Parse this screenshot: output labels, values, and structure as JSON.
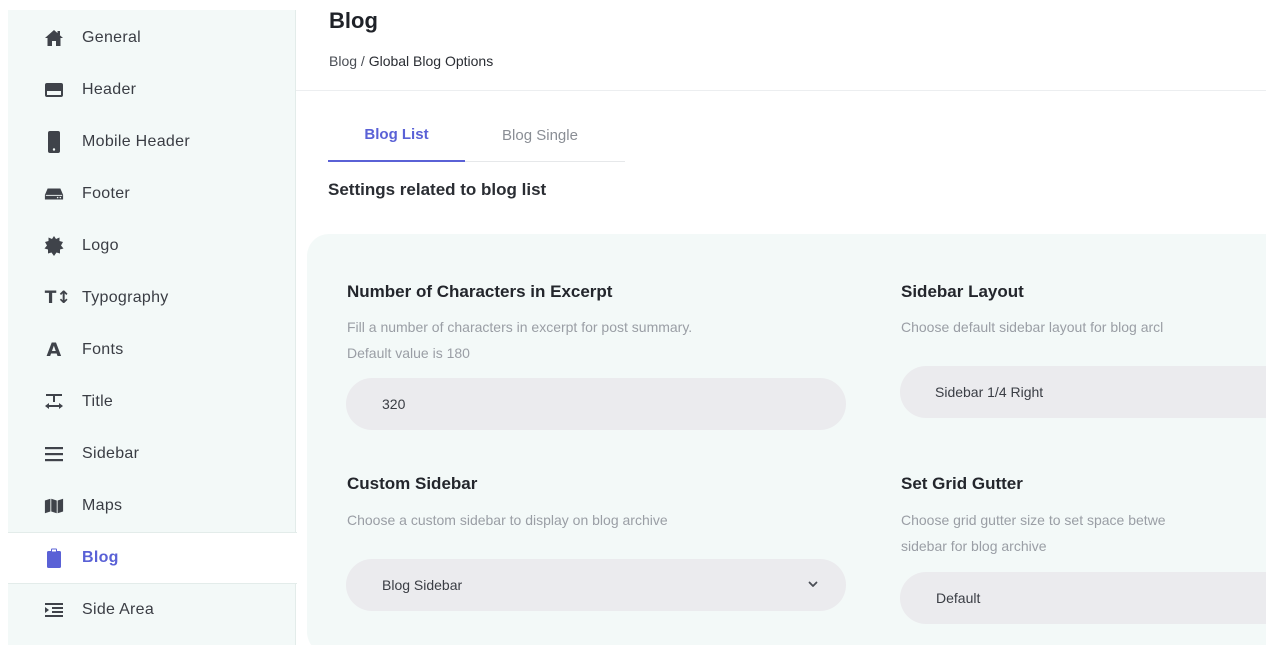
{
  "sidebar": {
    "items": [
      {
        "label": "General",
        "icon": "home-icon"
      },
      {
        "label": "Header",
        "icon": "header-icon"
      },
      {
        "label": "Mobile Header",
        "icon": "mobile-icon"
      },
      {
        "label": "Footer",
        "icon": "footer-icon"
      },
      {
        "label": "Logo",
        "icon": "logo-icon"
      },
      {
        "label": "Typography",
        "icon": "typography-icon"
      },
      {
        "label": "Fonts",
        "icon": "fonts-icon"
      },
      {
        "label": "Title",
        "icon": "title-icon"
      },
      {
        "label": "Sidebar",
        "icon": "sidebar-icon"
      },
      {
        "label": "Maps",
        "icon": "map-icon"
      },
      {
        "label": "Blog",
        "icon": "clipboard-icon",
        "active": true
      },
      {
        "label": "Side Area",
        "icon": "indent-icon"
      }
    ]
  },
  "header": {
    "title": "Blog",
    "breadcrumb_root": "Blog",
    "breadcrumb_sep": " / ",
    "breadcrumb_current": "Global Blog Options"
  },
  "tabs": [
    {
      "label": "Blog List",
      "active": true
    },
    {
      "label": "Blog Single",
      "active": false
    }
  ],
  "section_desc": "Settings related to blog list",
  "fields": {
    "excerpt": {
      "label": "Number of Characters in Excerpt",
      "help_line1": "Fill a number of characters in excerpt for post summary.",
      "help_line2": "Default value is 180",
      "value": "320"
    },
    "sidebar_layout": {
      "label": "Sidebar Layout",
      "help_line1": "Choose default sidebar layout for blog arcl",
      "value": "Sidebar 1/4 Right"
    },
    "custom_sidebar": {
      "label": "Custom Sidebar",
      "help_line1": "Choose a custom sidebar to display on blog archive",
      "value": "Blog Sidebar"
    },
    "grid_gutter": {
      "label": "Set Grid Gutter",
      "help_line1": "Choose grid gutter size to set space betwe",
      "help_line2": "sidebar for blog archive",
      "value": "Default"
    }
  },
  "colors": {
    "accent": "#5a61d6",
    "sidebar_bg": "#f3f9f8",
    "input_bg": "#ebebee"
  }
}
